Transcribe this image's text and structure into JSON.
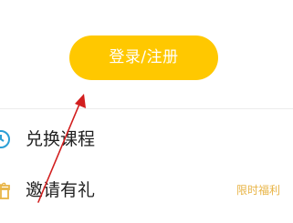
{
  "colors": {
    "accent": "#ffc800",
    "badge": "#e8b446",
    "text": "#222222",
    "icon": "#2a9fd6",
    "annotation": "#d21e1e"
  },
  "login": {
    "label": "登录/注册"
  },
  "menu": {
    "items": [
      {
        "label": "兑换课程",
        "icon": "clock-icon"
      },
      {
        "label": "邀请有礼",
        "icon": "gift-icon",
        "badge": "限时福利"
      }
    ]
  }
}
